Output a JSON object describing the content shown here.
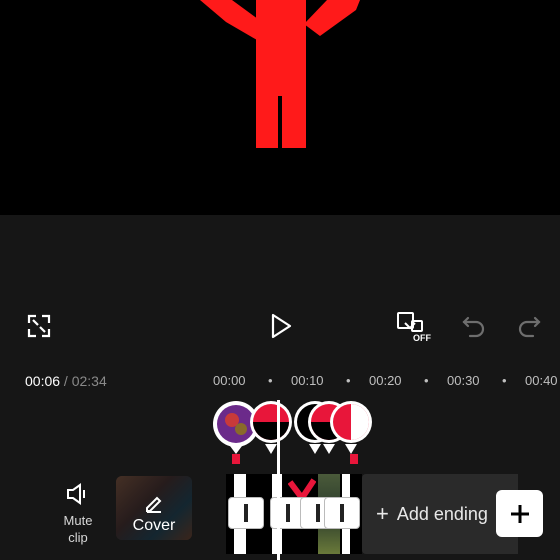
{
  "preview": {
    "figure_color": "#ff1a1a"
  },
  "controls": {
    "fullscreen_icon": "fullscreen-icon",
    "play_icon": "play-icon",
    "keyframe_icon": "keyframe-off-icon",
    "keyframe_badge": "OFF",
    "undo_icon": "undo-icon",
    "redo_icon": "redo-icon"
  },
  "timeline": {
    "current_time": "00:06",
    "separator": " / ",
    "total_time": "02:34",
    "ticks": [
      "00:00",
      "00:10",
      "00:20",
      "00:30",
      "00:40"
    ]
  },
  "tools": {
    "mute_label_line1": "Mute",
    "mute_label_line2": "clip",
    "cover_label": "Cover"
  },
  "track": {
    "add_ending_label": "Add ending",
    "add_ending_plus": "+"
  },
  "colors": {
    "accent_red": "#e8163a",
    "editor_bg": "#161616"
  }
}
